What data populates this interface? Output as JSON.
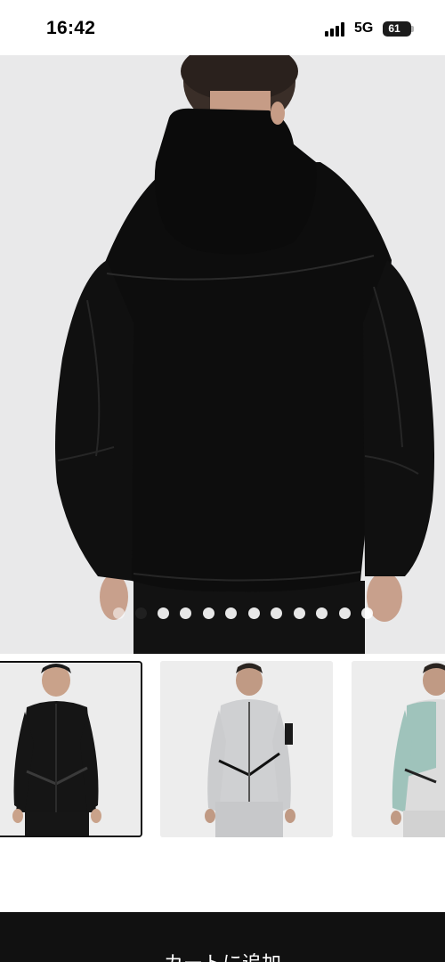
{
  "status_bar": {
    "time": "16:42",
    "network": "5G",
    "battery": "61",
    "icons": [
      "signal-icon",
      "battery-icon"
    ]
  },
  "product_gallery": {
    "main_image": "black hooded zip jacket, back view",
    "dots_total": 12,
    "active_dot": 1,
    "thumbnails": [
      {
        "alt": "black zip hoodie front",
        "color": "#151515",
        "selected": true
      },
      {
        "alt": "light grey zip hoodie front",
        "color": "#cfd0d2",
        "selected": false
      },
      {
        "alt": "mint and grey zip hoodie front",
        "color": "#9fc3bb",
        "selected": false
      }
    ]
  },
  "cart": {
    "label": "カートに追加"
  },
  "colors": {
    "background": "#ffffff",
    "image_bg": "#e9e9ea",
    "cart_bar": "#111111",
    "garment": "#0d0d0d"
  }
}
